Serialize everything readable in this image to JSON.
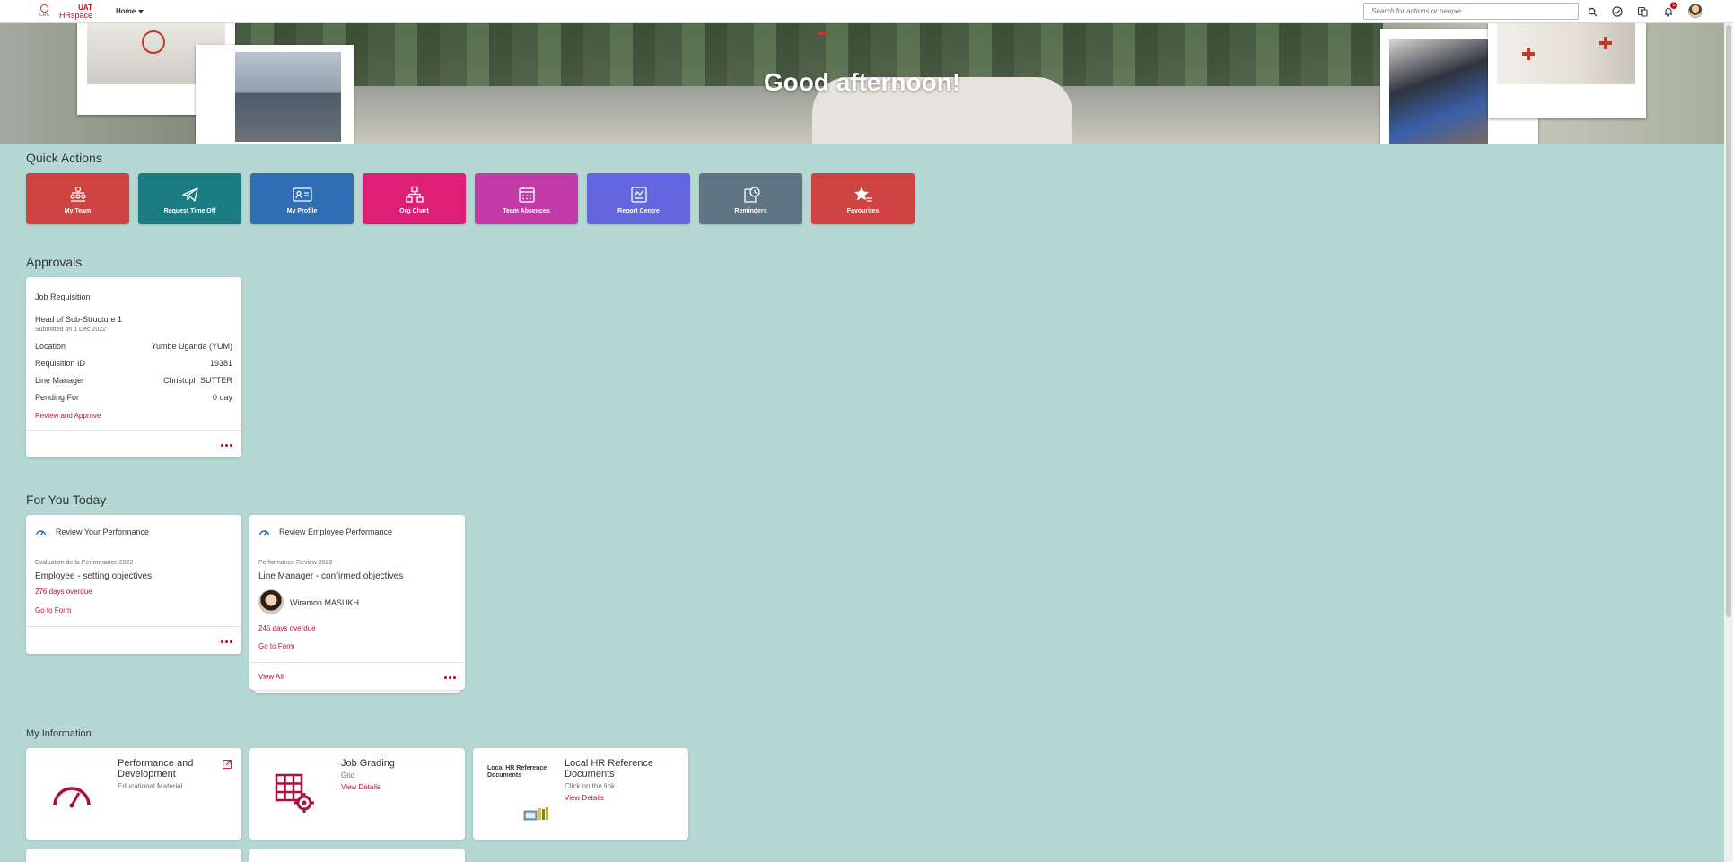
{
  "shell": {
    "logo_small_text": "ICRC",
    "brand_top": "UAT",
    "brand_bottom": "HRspace",
    "home_label": "Home",
    "search_placeholder": "Search for actions or people",
    "notification_count": "5"
  },
  "hero": {
    "greeting": "Good afternoon!"
  },
  "quick_actions": {
    "title": "Quick Actions",
    "items": [
      {
        "label": "My Team",
        "color": "#d04343"
      },
      {
        "label": "Request Time Off",
        "color": "#1b7d83"
      },
      {
        "label": "My Profile",
        "color": "#2f6db5"
      },
      {
        "label": "Org Chart",
        "color": "#de1f75"
      },
      {
        "label": "Team Absences",
        "color": "#c23ba8"
      },
      {
        "label": "Report Centre",
        "color": "#6366df"
      },
      {
        "label": "Reminders",
        "color": "#5f7584"
      },
      {
        "label": "Favourites",
        "color": "#d04343"
      }
    ]
  },
  "approvals": {
    "title": "Approvals",
    "card": {
      "type": "Job Requisition",
      "position": "Head of Sub-Structure 1",
      "submitted": "Submitted on 1 Dec 2022",
      "rows": [
        {
          "label": "Location",
          "value": "Yumbe Uganda (YUM)"
        },
        {
          "label": "Requisition ID",
          "value": "19381"
        },
        {
          "label": "Line Manager",
          "value": "Christoph SUTTER"
        },
        {
          "label": "Pending For",
          "value": "0 day"
        }
      ],
      "action": "Review and Approve"
    }
  },
  "for_you_today": {
    "title": "For You Today",
    "card1": {
      "header": "Review Your Performance",
      "form": "Evaluation de la Performance 2022",
      "step": "Employee - setting objectives",
      "overdue": "276 days overdue",
      "link": "Go to Form"
    },
    "card2": {
      "header": "Review Employee Performance",
      "form": "Performance Review 2022",
      "step": "Line Manager - confirmed objectives",
      "person": "Wiramon MASUKH",
      "overdue": "245 days overdue",
      "link": "Go to Form",
      "view_all": "View All"
    }
  },
  "my_information": {
    "title": "My Information",
    "tiles": [
      {
        "title": "Performance and Development",
        "subtitle": "Educational Material"
      },
      {
        "title": "Job Grading",
        "subtitle": "Grid",
        "link": "View Details"
      },
      {
        "title": "Local HR Reference Documents",
        "subtitle": "Click on the link",
        "link": "View Details",
        "image_text": "Local HR Reference Documents"
      }
    ]
  }
}
